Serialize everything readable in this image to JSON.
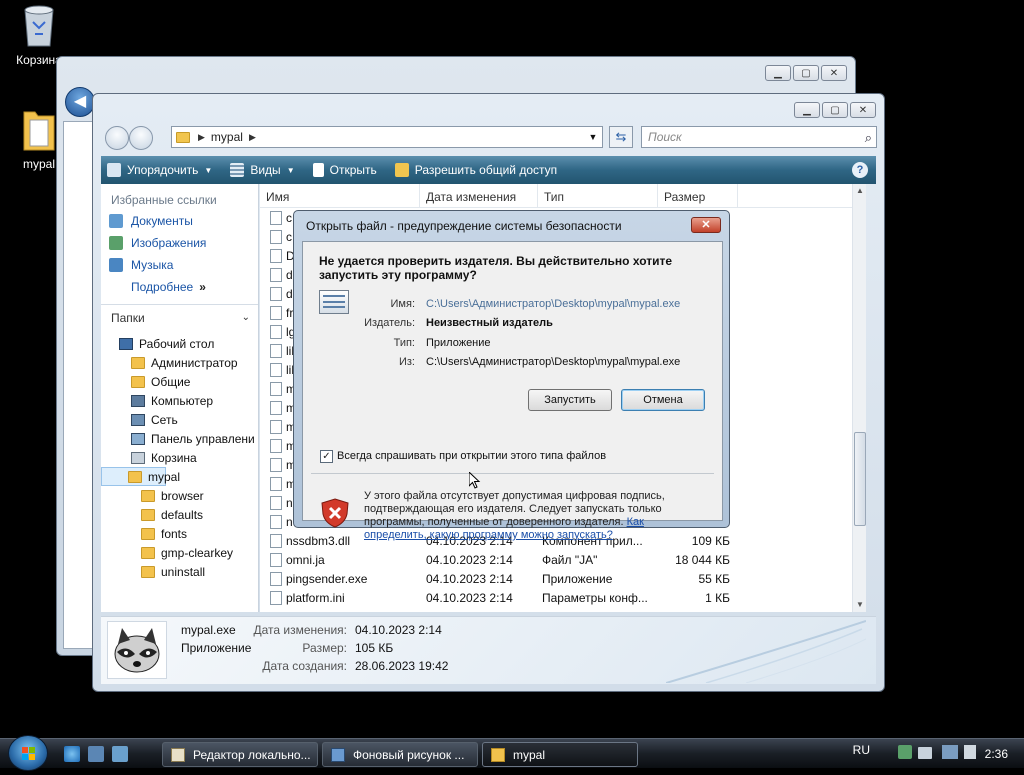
{
  "desktop": {
    "recycle_label": "Корзина",
    "mypal_label": "mypal"
  },
  "explorer": {
    "breadcrumb": "mypal",
    "search_placeholder": "Поиск",
    "toolbar": {
      "organize": "Упорядочить",
      "views": "Виды",
      "open": "Открыть",
      "share": "Разрешить общий доступ"
    },
    "nav": {
      "favorites_header": "Избранные ссылки",
      "favorites": [
        "Документы",
        "Изображения",
        "Музыка"
      ],
      "more": "Подробнее",
      "folders_header": "Папки",
      "tree": [
        "Рабочий стол",
        "Администратор",
        "Общие",
        "Компьютер",
        "Сеть",
        "Панель управлени",
        "Корзина",
        "mypal",
        "browser",
        "defaults",
        "fonts",
        "gmp-clearkey",
        "uninstall"
      ]
    },
    "columns": {
      "name": "Имя",
      "date": "Дата изменения",
      "type": "Тип",
      "size": "Размер"
    },
    "partial_rows": [
      "c",
      "c",
      "D",
      "d",
      "d",
      "fr",
      "lg",
      "lil",
      "lil",
      "m",
      "m",
      "m",
      "m",
      "m",
      "m",
      "n",
      "n"
    ],
    "rows": [
      {
        "name": "nssdbm3.dll",
        "date": "04.10.2023 2:14",
        "type": "Компонент прил...",
        "size": "109 КБ"
      },
      {
        "name": "omni.ja",
        "date": "04.10.2023 2:14",
        "type": "Файл \"JA\"",
        "size": "18 044 КБ"
      },
      {
        "name": "pingsender.exe",
        "date": "04.10.2023 2:14",
        "type": "Приложение",
        "size": "55 КБ"
      },
      {
        "name": "platform.ini",
        "date": "04.10.2023 2:14",
        "type": "Параметры конф...",
        "size": "1 КБ"
      }
    ],
    "details": {
      "file_name": "mypal.exe",
      "file_type": "Приложение",
      "modified_label": "Дата изменения:",
      "modified_value": "04.10.2023 2:14",
      "size_label": "Размер:",
      "size_value": "105 КБ",
      "created_label": "Дата создания:",
      "created_value": "28.06.2023 19:42"
    }
  },
  "dialog": {
    "title": "Открыть файл - предупреждение системы безопасности",
    "question": "Не удается проверить издателя.  Вы действительно хотите запустить эту программу?",
    "name_label": "Имя:",
    "name_value": "C:\\Users\\Администратор\\Desktop\\mypal\\mypal.exe",
    "publisher_label": "Издатель:",
    "publisher_value": "Неизвестный издатель",
    "type_label": "Тип:",
    "type_value": "Приложение",
    "from_label": "Из:",
    "from_value": "C:\\Users\\Администратор\\Desktop\\mypal\\mypal.exe",
    "run_button": "Запустить",
    "cancel_button": "Отмена",
    "checkbox_label": "Всегда спрашивать при открытии этого типа файлов",
    "warning_text": "У этого файла отсутствует допустимая цифровая подпись, подтверждающая его издателя.  Следует запускать только программы, полученные от доверенного издателя. ",
    "warning_link": "Как определить, какую программу можно запускать?"
  },
  "taskbar": {
    "tasks": [
      "Редактор локально...",
      "Фоновый рисунок ...",
      "mypal"
    ],
    "language": "RU",
    "time": "2:36"
  },
  "colors": {
    "toolbar": "#2f6685",
    "link": "#1b55a6",
    "close_button": "#c2412a"
  }
}
